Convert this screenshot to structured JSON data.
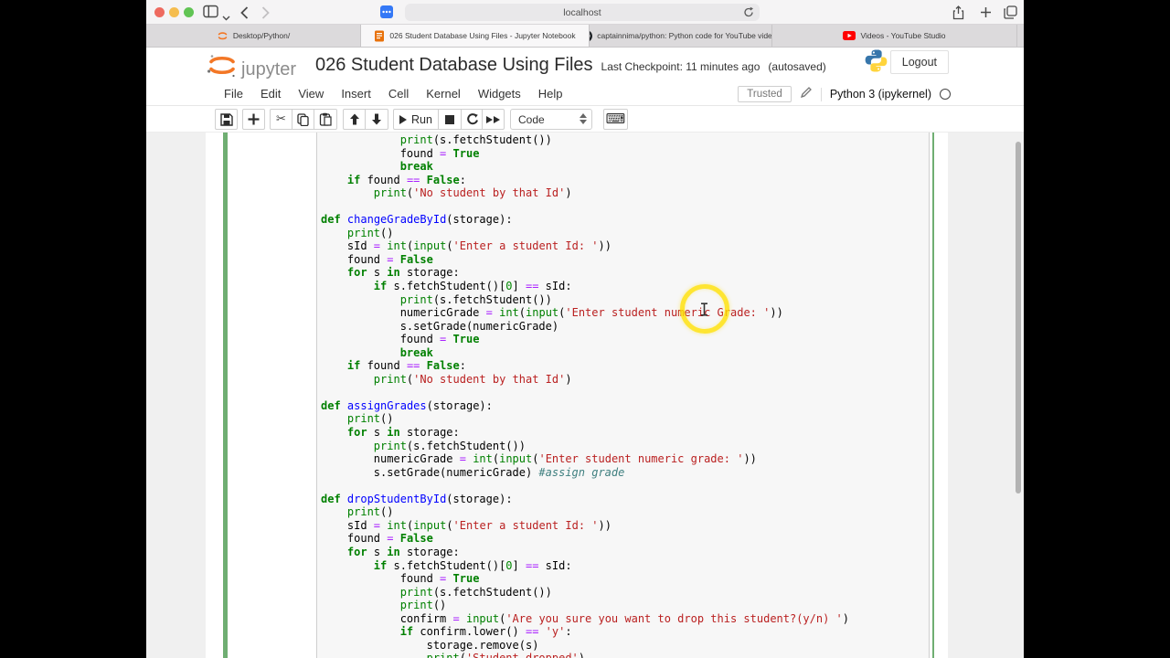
{
  "colors": {
    "cell_border_green": "#6fae72",
    "jupyter_orange": "#F37726",
    "code_background": "#f7f7f7",
    "page_margin_gray": "#f0f0f0",
    "click_ring_yellow": "#ffe000",
    "string_red": "#BA2121",
    "keyword_green": "#008000",
    "operator_purple": "#AA22FF"
  },
  "browser": {
    "url": "localhost",
    "tabs": [
      {
        "icon": "jupyter-icon",
        "title": "Desktop/Python/",
        "active": false
      },
      {
        "icon": "notebook-icon",
        "title": "026 Student Database Using Files - Jupyter Notebook",
        "active": true
      },
      {
        "icon": "github-icon",
        "title": "captainnima/python: Python code for YouTube videos",
        "active": false
      },
      {
        "icon": "youtube-icon",
        "title": "Videos - YouTube Studio",
        "active": false
      }
    ]
  },
  "header": {
    "logo_text": "jupyter",
    "title": "026 Student Database Using Files",
    "checkpoint": "Last Checkpoint: 11 minutes ago",
    "autosaved": "(autosaved)",
    "logout_label": "Logout"
  },
  "menu": {
    "items": [
      "File",
      "Edit",
      "View",
      "Insert",
      "Cell",
      "Kernel",
      "Widgets",
      "Help"
    ],
    "trusted_label": "Trusted",
    "kernel_name": "Python 3 (ipykernel)"
  },
  "toolbar": {
    "run_label": "Run",
    "cell_type": "Code"
  },
  "code": {
    "lines": [
      [
        [
          "t",
          "            "
        ],
        [
          "b",
          "print"
        ],
        [
          "t",
          "(s.fetchStudent())"
        ]
      ],
      [
        [
          "t",
          "            found "
        ],
        [
          "o",
          "="
        ],
        [
          "t",
          " "
        ],
        [
          "k",
          "True"
        ]
      ],
      [
        [
          "t",
          "            "
        ],
        [
          "k",
          "break"
        ]
      ],
      [
        [
          "t",
          "    "
        ],
        [
          "k",
          "if"
        ],
        [
          "t",
          " found "
        ],
        [
          "o",
          "=="
        ],
        [
          "t",
          " "
        ],
        [
          "k",
          "False"
        ],
        [
          "t",
          ":"
        ]
      ],
      [
        [
          "t",
          "        "
        ],
        [
          "b",
          "print"
        ],
        [
          "t",
          "("
        ],
        [
          "s",
          "'No student by that Id'"
        ],
        [
          "t",
          ")"
        ]
      ],
      [],
      [
        [
          "k",
          "def"
        ],
        [
          "t",
          " "
        ],
        [
          "f",
          "changeGradeById"
        ],
        [
          "t",
          "(storage):"
        ]
      ],
      [
        [
          "t",
          "    "
        ],
        [
          "b",
          "print"
        ],
        [
          "t",
          "()"
        ]
      ],
      [
        [
          "t",
          "    sId "
        ],
        [
          "o",
          "="
        ],
        [
          "t",
          " "
        ],
        [
          "b",
          "int"
        ],
        [
          "t",
          "("
        ],
        [
          "b",
          "input"
        ],
        [
          "t",
          "("
        ],
        [
          "s",
          "'Enter a student Id: '"
        ],
        [
          "t",
          "))"
        ]
      ],
      [
        [
          "t",
          "    found "
        ],
        [
          "o",
          "="
        ],
        [
          "t",
          " "
        ],
        [
          "k",
          "False"
        ]
      ],
      [
        [
          "t",
          "    "
        ],
        [
          "k",
          "for"
        ],
        [
          "t",
          " s "
        ],
        [
          "k",
          "in"
        ],
        [
          "t",
          " storage:"
        ]
      ],
      [
        [
          "t",
          "        "
        ],
        [
          "k",
          "if"
        ],
        [
          "t",
          " s.fetchStudent()["
        ],
        [
          "n",
          "0"
        ],
        [
          "t",
          "] "
        ],
        [
          "o",
          "=="
        ],
        [
          "t",
          " sId:"
        ]
      ],
      [
        [
          "t",
          "            "
        ],
        [
          "b",
          "print"
        ],
        [
          "t",
          "(s.fetchStudent())"
        ]
      ],
      [
        [
          "t",
          "            numericGrade "
        ],
        [
          "o",
          "="
        ],
        [
          "t",
          " "
        ],
        [
          "b",
          "int"
        ],
        [
          "t",
          "("
        ],
        [
          "b",
          "input"
        ],
        [
          "t",
          "("
        ],
        [
          "s",
          "'Enter student numeric Grade: '"
        ],
        [
          "t",
          "))"
        ]
      ],
      [
        [
          "t",
          "            s.setGrade(numericGrade)"
        ]
      ],
      [
        [
          "t",
          "            found "
        ],
        [
          "o",
          "="
        ],
        [
          "t",
          " "
        ],
        [
          "k",
          "True"
        ]
      ],
      [
        [
          "t",
          "            "
        ],
        [
          "k",
          "break"
        ]
      ],
      [
        [
          "t",
          "    "
        ],
        [
          "k",
          "if"
        ],
        [
          "t",
          " found "
        ],
        [
          "o",
          "=="
        ],
        [
          "t",
          " "
        ],
        [
          "k",
          "False"
        ],
        [
          "t",
          ":"
        ]
      ],
      [
        [
          "t",
          "        "
        ],
        [
          "b",
          "print"
        ],
        [
          "t",
          "("
        ],
        [
          "s",
          "'No student by that Id'"
        ],
        [
          "t",
          ")"
        ]
      ],
      [],
      [
        [
          "k",
          "def"
        ],
        [
          "t",
          " "
        ],
        [
          "f",
          "assignGrades"
        ],
        [
          "t",
          "(storage):"
        ]
      ],
      [
        [
          "t",
          "    "
        ],
        [
          "b",
          "print"
        ],
        [
          "t",
          "()"
        ]
      ],
      [
        [
          "t",
          "    "
        ],
        [
          "k",
          "for"
        ],
        [
          "t",
          " s "
        ],
        [
          "k",
          "in"
        ],
        [
          "t",
          " storage:"
        ]
      ],
      [
        [
          "t",
          "        "
        ],
        [
          "b",
          "print"
        ],
        [
          "t",
          "(s.fetchStudent())"
        ]
      ],
      [
        [
          "t",
          "        numericGrade "
        ],
        [
          "o",
          "="
        ],
        [
          "t",
          " "
        ],
        [
          "b",
          "int"
        ],
        [
          "t",
          "("
        ],
        [
          "b",
          "input"
        ],
        [
          "t",
          "("
        ],
        [
          "s",
          "'Enter student numeric grade: '"
        ],
        [
          "t",
          "))"
        ]
      ],
      [
        [
          "t",
          "        s.setGrade(numericGrade) "
        ],
        [
          "c",
          "#assign grade"
        ]
      ],
      [],
      [
        [
          "k",
          "def"
        ],
        [
          "t",
          " "
        ],
        [
          "f",
          "dropStudentById"
        ],
        [
          "t",
          "(storage):"
        ]
      ],
      [
        [
          "t",
          "    "
        ],
        [
          "b",
          "print"
        ],
        [
          "t",
          "()"
        ]
      ],
      [
        [
          "t",
          "    sId "
        ],
        [
          "o",
          "="
        ],
        [
          "t",
          " "
        ],
        [
          "b",
          "int"
        ],
        [
          "t",
          "("
        ],
        [
          "b",
          "input"
        ],
        [
          "t",
          "("
        ],
        [
          "s",
          "'Enter a student Id: '"
        ],
        [
          "t",
          "))"
        ]
      ],
      [
        [
          "t",
          "    found "
        ],
        [
          "o",
          "="
        ],
        [
          "t",
          " "
        ],
        [
          "k",
          "False"
        ]
      ],
      [
        [
          "t",
          "    "
        ],
        [
          "k",
          "for"
        ],
        [
          "t",
          " s "
        ],
        [
          "k",
          "in"
        ],
        [
          "t",
          " storage:"
        ]
      ],
      [
        [
          "t",
          "        "
        ],
        [
          "k",
          "if"
        ],
        [
          "t",
          " s.fetchStudent()["
        ],
        [
          "n",
          "0"
        ],
        [
          "t",
          "] "
        ],
        [
          "o",
          "=="
        ],
        [
          "t",
          " sId:"
        ]
      ],
      [
        [
          "t",
          "            found "
        ],
        [
          "o",
          "="
        ],
        [
          "t",
          " "
        ],
        [
          "k",
          "True"
        ]
      ],
      [
        [
          "t",
          "            "
        ],
        [
          "b",
          "print"
        ],
        [
          "t",
          "(s.fetchStudent())"
        ]
      ],
      [
        [
          "t",
          "            "
        ],
        [
          "b",
          "print"
        ],
        [
          "t",
          "()"
        ]
      ],
      [
        [
          "t",
          "            confirm "
        ],
        [
          "o",
          "="
        ],
        [
          "t",
          " "
        ],
        [
          "b",
          "input"
        ],
        [
          "t",
          "("
        ],
        [
          "s",
          "'Are you sure you want to drop this student?(y/n) '"
        ],
        [
          "t",
          ")"
        ]
      ],
      [
        [
          "t",
          "            "
        ],
        [
          "k",
          "if"
        ],
        [
          "t",
          " confirm.lower() "
        ],
        [
          "o",
          "=="
        ],
        [
          "t",
          " "
        ],
        [
          "s",
          "'y'"
        ],
        [
          "t",
          ":"
        ]
      ],
      [
        [
          "t",
          "                storage.remove(s)"
        ]
      ],
      [
        [
          "t",
          "                "
        ],
        [
          "b",
          "print"
        ],
        [
          "t",
          "("
        ],
        [
          "s",
          "'Student dropped'"
        ],
        [
          "t",
          ")"
        ]
      ]
    ]
  }
}
